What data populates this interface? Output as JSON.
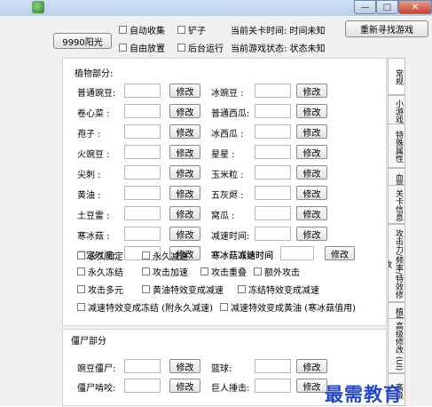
{
  "window": {
    "min_symbol": "—",
    "max_symbol": "□",
    "close_symbol": "✕"
  },
  "toolbar": {
    "sun_button": "9990阳光",
    "auto_collect": "自动收集",
    "shovel": "铲子",
    "free_place": "自由放置",
    "background_run": "后台运行",
    "level_time": "当前关卡时间: 时间未知",
    "game_status": "当前游戏状态: 状态未知",
    "research_button": "重新寻找游戏"
  },
  "plants": {
    "title": "植物部分:",
    "modify_label": "修改",
    "rows": [
      {
        "left": "普通豌豆:",
        "right": "冰豌豆 :"
      },
      {
        "left": "卷心菜 :",
        "right": "普通西瓜:"
      },
      {
        "left": "孢子 :",
        "right": "冰西瓜 :"
      },
      {
        "left": "火豌豆 :",
        "right": "星星 :"
      },
      {
        "left": "尖刺 :",
        "right": "玉米粒 :"
      },
      {
        "left": "黄油 :",
        "right": "五灰烬 :"
      },
      {
        "left": "土豆雷 :",
        "right": "窝瓜 :"
      },
      {
        "left": "寒冰菇 :",
        "right": "减速时间:"
      },
      {
        "left": "固定时间:",
        "right": "寒冰菇冻结时间"
      }
    ],
    "extra_label": "寒冰菇减速时间",
    "options": {
      "perm_fix": "永久固定",
      "perm_slow": "永久减速",
      "perm_freeze": "永久冻结",
      "attack_speed": "攻击加速",
      "attack_overlap": "攻击重叠",
      "extra_attack": "额外攻击",
      "multi_attack": "攻击多元",
      "butter_to_slow": "黄油特效变成减速",
      "freeze_to_slow": "冻结特效变成减速",
      "slow_to_freeze": "减速特效变成冻结 (附永久减速)",
      "slow_to_butter": "减速特效变成黄油 (寒冰菇值用)"
    }
  },
  "zombies": {
    "title": "僵尸部分",
    "rows": [
      {
        "left": "豌豆僵尸:",
        "right": "篮球:"
      },
      {
        "left": "僵尸啃咬:",
        "right": "巨人捶击:"
      }
    ]
  },
  "tabs": [
    "常规",
    "小游戏修改",
    "特殊属性",
    "血量修改",
    "关卡信息",
    "攻击力/频率/特效修改",
    "植物卡槽属性修改",
    "高级修改 (UI)",
    "高级"
  ],
  "watermark": "最需教育"
}
